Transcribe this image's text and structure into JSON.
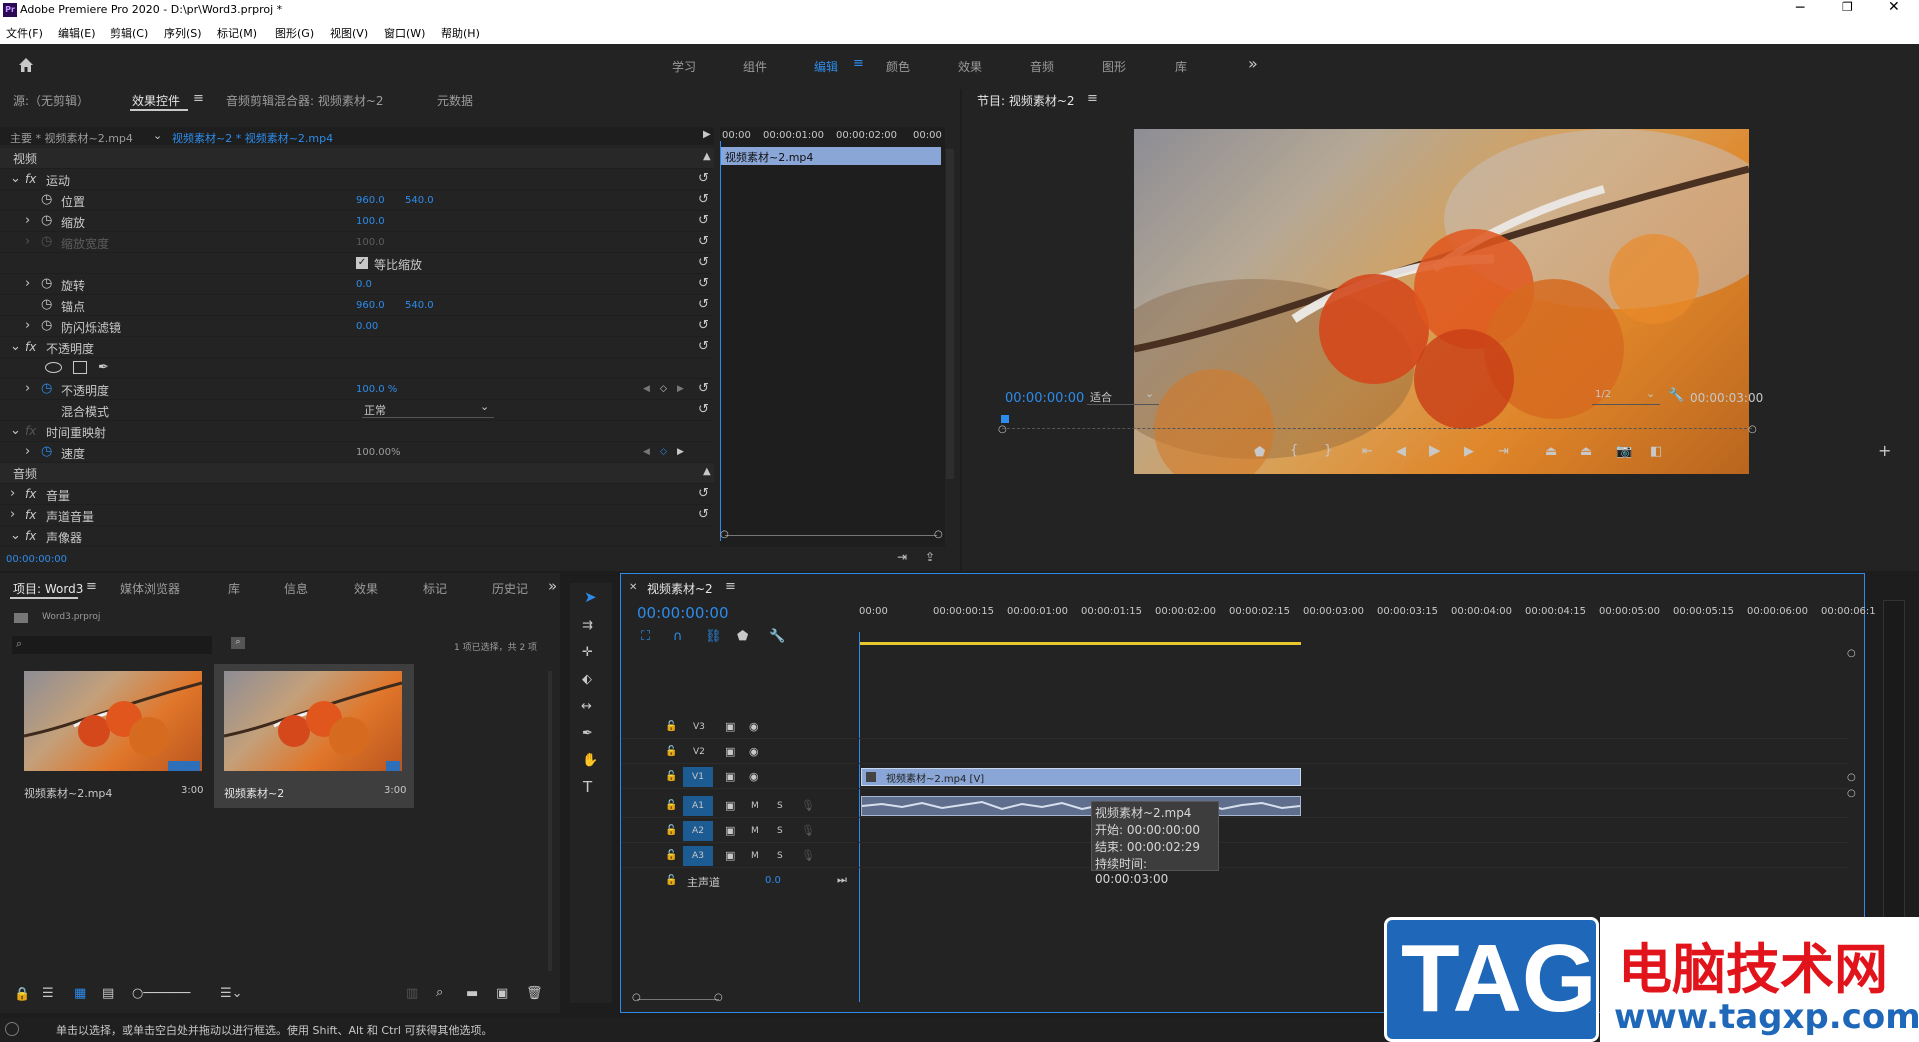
{
  "app": {
    "title": "Adobe Premiere Pro 2020 - D:\\pr\\Word3.prproj *",
    "icon_label": "Pr"
  },
  "menu": [
    "文件(F)",
    "编辑(E)",
    "剪辑(C)",
    "序列(S)",
    "标记(M)",
    "图形(G)",
    "视图(V)",
    "窗口(W)",
    "帮助(H)"
  ],
  "workspaces": {
    "items": [
      "学习",
      "组件",
      "编辑",
      "颜色",
      "效果",
      "音频",
      "图形",
      "库"
    ],
    "active": "编辑"
  },
  "source_panel": {
    "tabs": [
      "源:（无剪辑）",
      "效果控件",
      "音频剪辑混合器: 视频素材~2",
      "元数据"
    ],
    "active_tab": "效果控件",
    "master_clip": "主要 * 视频素材~2.mp4",
    "seq_clip": "视频素材~2 * 视频素材~2.mp4",
    "mini_ruler": [
      "00:00",
      "00:00:01:00",
      "00:00:02:00",
      "00:00"
    ],
    "mini_clip": "视频素材~2.mp4",
    "video_header": "视频",
    "motion": "运动",
    "position": {
      "label": "位置",
      "x": "960.0",
      "y": "540.0"
    },
    "scale": {
      "label": "缩放",
      "value": "100.0"
    },
    "scale_width": {
      "label": "缩放宽度",
      "value": "100.0"
    },
    "uniform_scale": "等比缩放",
    "rotation": {
      "label": "旋转",
      "value": "0.0"
    },
    "anchor": {
      "label": "锚点",
      "x": "960.0",
      "y": "540.0"
    },
    "antiflicker": {
      "label": "防闪烁滤镜",
      "value": "0.00"
    },
    "opacity_fx": "不透明度",
    "opacity": {
      "label": "不透明度",
      "value": "100.0 %"
    },
    "blend": {
      "label": "混合模式",
      "value": "正常"
    },
    "time_remap": "时间重映射",
    "speed": {
      "label": "速度",
      "value": "100.00%"
    },
    "audio_header": "音频",
    "volume": "音量",
    "channel_volume": "声道音量",
    "panner": "声像器",
    "timecode": "00:00:00:00"
  },
  "program": {
    "title": "节目: 视频素材~2",
    "timecode": "00:00:00:00",
    "fit": "适合",
    "quality": "1/2",
    "duration": "00:00:03:00"
  },
  "project": {
    "tabs": [
      "项目: Word3",
      "媒体浏览器",
      "库",
      "信息",
      "效果",
      "标记",
      "历史记"
    ],
    "active_tab": "项目: Word3",
    "file": "Word3.prproj",
    "search_placeholder": "",
    "selection_info": "1 项已选择，共 2 项",
    "items": [
      {
        "name": "视频素材~2.mp4",
        "duration": "3:00"
      },
      {
        "name": "视频素材~2",
        "duration": "3:00"
      }
    ]
  },
  "timeline": {
    "title": "视频素材~2",
    "timecode": "00:00:00:00",
    "ruler": [
      "00:00",
      "00:00:00:15",
      "00:00:01:00",
      "00:00:01:15",
      "00:00:02:00",
      "00:00:02:15",
      "00:00:03:00",
      "00:00:03:15",
      "00:00:04:00",
      "00:00:04:15",
      "00:00:05:00",
      "00:00:05:15",
      "00:00:06:00",
      "00:00:06:1"
    ],
    "video_tracks": [
      "V3",
      "V2",
      "V1"
    ],
    "audio_tracks": [
      "A1",
      "A2",
      "A3"
    ],
    "master": {
      "label": "主声道",
      "value": "0.0"
    },
    "video_clip": "视频素材~2.mp4 [V]",
    "tooltip": {
      "name": "视频素材~2.mp4",
      "start": "开始: 00:00:00:00",
      "end": "结束: 00:00:02:29",
      "duration": "持续时间: 00:00:03:00"
    }
  },
  "status_bar": "单击以选择，或单击空白处并拖动以进行框选。使用 Shift、Alt 和 Ctrl 可获得其他选项。",
  "watermark": {
    "tag": "TAG",
    "cn": "电脑技术网",
    "url": "www.tagxp.com"
  },
  "colors": {
    "accent": "#2d8ceb",
    "panel": "#232323",
    "work_area": "#e8c62d",
    "clip_video": "#8aa6d6",
    "clip_audio": "#5e6e8c"
  }
}
